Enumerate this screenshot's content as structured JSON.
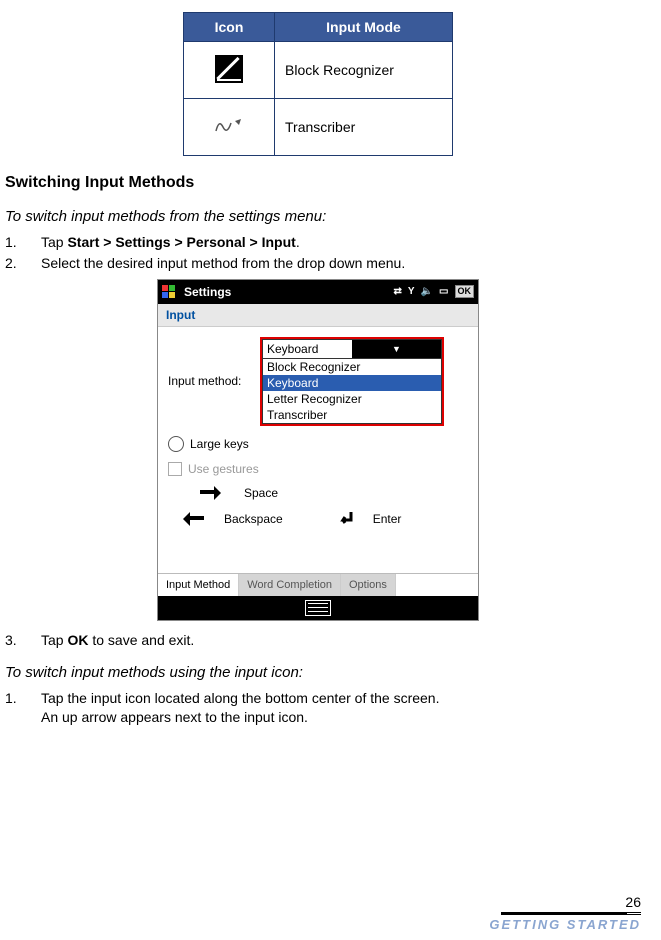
{
  "table": {
    "header_icon": "Icon",
    "header_mode": "Input Mode",
    "rows": [
      {
        "mode": "Block Recognizer"
      },
      {
        "mode": "Transcriber"
      }
    ]
  },
  "section_heading": "Switching Input Methods",
  "subhead1": "To switch input methods from the settings menu:",
  "steps1": {
    "s1_pre": "Tap ",
    "s1_bold": "Start > Settings > Personal > Input",
    "s1_post": ".",
    "s2": "Select the desired input method from the drop down menu."
  },
  "screenshot": {
    "titlebar": "Settings",
    "ok": "OK",
    "subhead": "Input",
    "label_inputmethod": "Input method:",
    "combo_current": "Keyboard",
    "combo_options": [
      "Block Recognizer",
      "Keyboard",
      "Letter Recognizer",
      "Transcriber"
    ],
    "combo_selected": "Keyboard",
    "large_keys": "Large keys",
    "use_gestures": "Use gestures",
    "space": "Space",
    "backspace": "Backspace",
    "enter": "Enter",
    "tabs": [
      "Input Method",
      "Word Completion",
      "Options"
    ]
  },
  "step3_pre": "Tap ",
  "step3_bold": "OK",
  "step3_post": " to save and exit.",
  "subhead2": "To switch input methods using the input icon:",
  "steps2": {
    "s1_line1": "Tap the input icon located along the bottom center of the screen.",
    "s1_line2": "An up arrow appears next to the input icon."
  },
  "footer": {
    "page": "26",
    "chapter": "Getting Started"
  }
}
